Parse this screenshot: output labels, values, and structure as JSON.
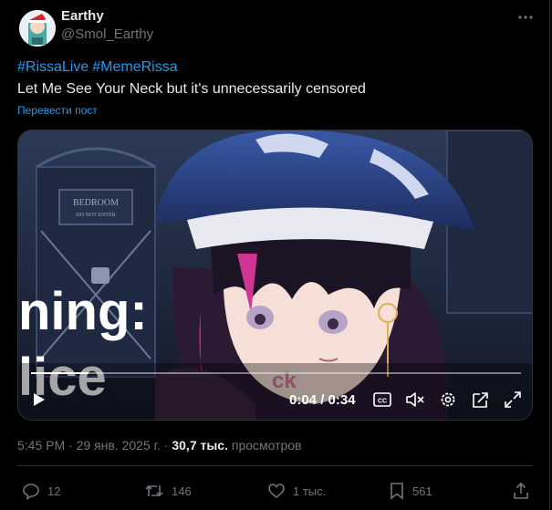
{
  "author": {
    "name": "Earthy",
    "handle": "@Smol_Earthy"
  },
  "hashtags": [
    "#RissaLive",
    "#MemeRissa"
  ],
  "text": "Let Me See Your Neck but it's unnecessarily censored",
  "translate_label": "Перевести пост",
  "video": {
    "time_label": "0:04 / 0:34",
    "progress": 0.118,
    "overlay_text_left_1": "ning:",
    "overlay_text_left_2": "lice",
    "overlay_text_center": "ck",
    "sign_line1": "BEDROOM",
    "sign_line2": "DO NOT ENTER"
  },
  "meta": {
    "time": "5:45 PM",
    "sep": "·",
    "date": "29 янв. 2025 г.",
    "views_count": "30,7 тыс.",
    "views_label": "просмотров"
  },
  "actions": {
    "replies": "12",
    "reposts": "146",
    "likes": "1 тыс.",
    "bookmarks": "561"
  },
  "icons": {
    "more": "more-dots-icon",
    "play": "play-icon",
    "cc": "captions-icon",
    "mute": "muted-speaker-icon",
    "settings": "gear-icon",
    "popout": "popout-icon",
    "fullscreen": "fullscreen-icon",
    "reply": "reply-icon",
    "repost": "repost-icon",
    "like": "heart-icon",
    "bookmark": "bookmark-icon",
    "share": "share-icon"
  },
  "colors": {
    "accent": "#1d9bf0",
    "muted": "#71767b",
    "text": "#e7e9ea",
    "border": "#2f3336"
  }
}
